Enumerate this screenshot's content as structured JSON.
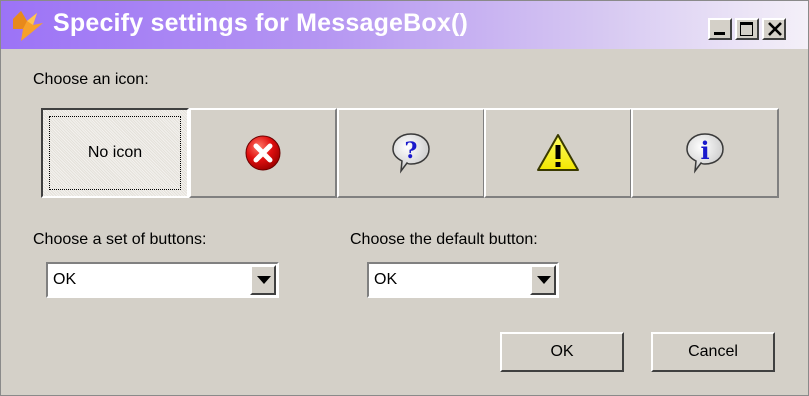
{
  "window": {
    "title": "Specify settings for MessageBox()",
    "app_icon": "fox-head-icon",
    "controls": [
      "minimize-icon",
      "maximize-icon",
      "close-icon"
    ],
    "colors": {
      "titlebar_start": "#9c73f6",
      "titlebar_end": "#f4f0f8",
      "face": "#d4d0c8"
    }
  },
  "icon_section": {
    "label": "Choose an icon:",
    "options": [
      {
        "label": "No icon",
        "icon": null,
        "selected": true
      },
      {
        "label": "",
        "icon": "error-icon",
        "selected": false
      },
      {
        "label": "",
        "icon": "question-icon",
        "selected": false
      },
      {
        "label": "",
        "icon": "warning-icon",
        "selected": false
      },
      {
        "label": "",
        "icon": "information-icon",
        "selected": false
      }
    ]
  },
  "buttons_set": {
    "label": "Choose a set of buttons:",
    "value": "OK"
  },
  "default_button": {
    "label": "Choose the default button:",
    "value": "OK"
  },
  "actions": {
    "ok_label": "OK",
    "cancel_label": "Cancel"
  }
}
